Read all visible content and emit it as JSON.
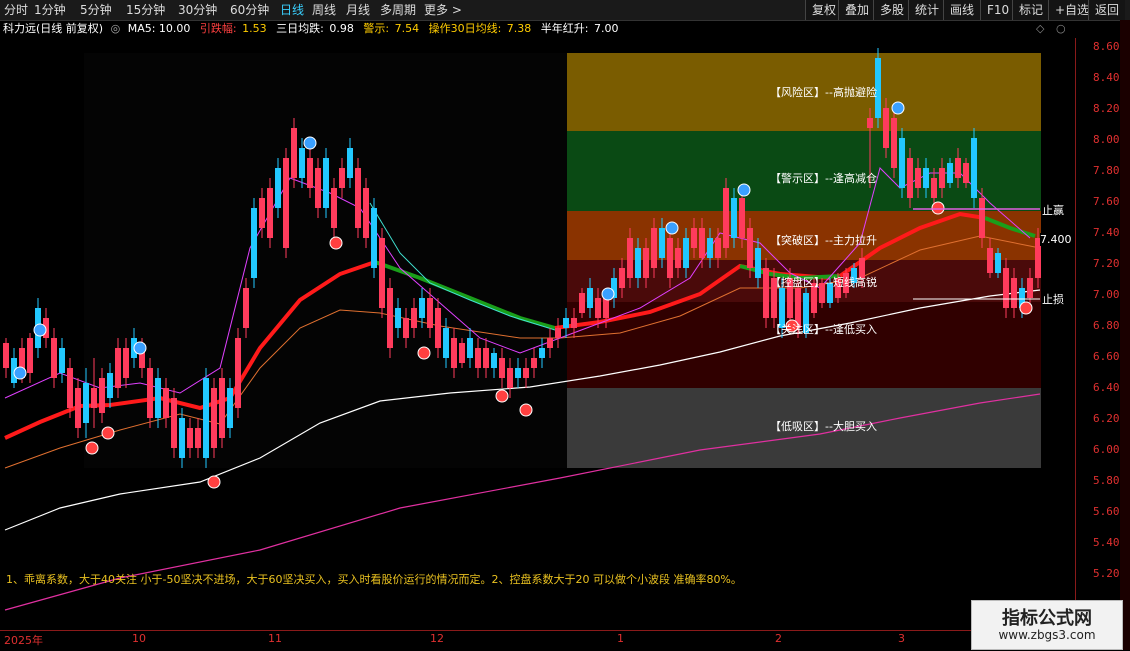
{
  "toolbar": {
    "periods": [
      "分时",
      "1分钟",
      "5分钟",
      "15分钟",
      "30分钟",
      "60分钟",
      "日线",
      "周线",
      "月线",
      "多周期",
      "更多 >"
    ],
    "active_period": "日线",
    "right_buttons": [
      "复权",
      "叠加",
      "多股",
      "统计",
      "画线",
      "F10",
      "标记",
      "+自选",
      "返回"
    ]
  },
  "infobar": {
    "title": "科力远(日线 前复权)",
    "ma5": "MA5: 10.00",
    "yinzhang_label": "引跌幅:",
    "yinzhang_value": "1.53",
    "sanri_label": "三日均跌:",
    "sanri_value": "0.98",
    "jingshi_label": "警示:",
    "jingshi_value": "7.54",
    "caozuo_label": "操作30日均线:",
    "caozuo_value": "7.38",
    "bannian_label": "半年红升:",
    "bannian_value": "7.00"
  },
  "zones": [
    {
      "label": "【风险区】--高抛避险",
      "color": "#7a5c00"
    },
    {
      "label": "【警示区】--逢高减仓",
      "color": "#0a4a14"
    },
    {
      "label": "【突破区】--主力拉升",
      "color": "#8a3300"
    },
    {
      "label": "【控盘区】--短线高锐",
      "color": "#4a0a0a"
    },
    {
      "label": "【关注区】--逢低买入",
      "color": "#300000"
    },
    {
      "label": "【低吸区】--大胆买入",
      "color": "#3a3a3a"
    }
  ],
  "side_labels": {
    "zhiying": "止赢",
    "zhisun": "止损",
    "current_price": "7.400"
  },
  "price_axis": [
    "8.60",
    "8.40",
    "8.20",
    "8.00",
    "7.80",
    "7.60",
    "7.40",
    "7.20",
    "7.00",
    "6.80",
    "6.60",
    "6.40",
    "6.20",
    "6.00",
    "5.80",
    "5.60",
    "5.40",
    "5.20"
  ],
  "date_axis": [
    "2025年",
    "10",
    "11",
    "12",
    "1",
    "2",
    "3"
  ],
  "note": "1、乖离系数，大于40关注 小于-50坚决不进场，大于60坚决买入，买入时看股价运行的情况而定。2、控盘系数大于20 可以做个小波段 准确率80%。",
  "watermark": {
    "title": "指标公式网",
    "url": "www.zbgs3.com"
  },
  "colors": {
    "up": "#ff3b5c",
    "down": "#22c8ff",
    "ma_red": "#ff1a1a",
    "ma_green": "#1a9e1a",
    "ma_white": "#ffffff",
    "ma_magenta": "#e030a0",
    "ma_orange": "#e07030"
  },
  "right_strip_icon": "vertical-panel-strip"
}
